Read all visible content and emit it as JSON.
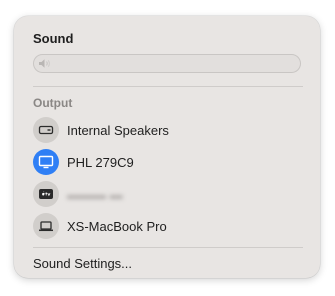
{
  "sound_menu": {
    "title": "Sound",
    "volume_icon": "speaker-muted-icon",
    "output_label": "Output",
    "devices": [
      {
        "label": "Internal Speakers",
        "icon": "speaker-device-icon",
        "selected": false
      },
      {
        "label": "PHL 279C9",
        "icon": "display-icon",
        "selected": true
      },
      {
        "label": "",
        "icon": "apple-tv-icon",
        "selected": false,
        "redacted": true
      },
      {
        "label": "XS-MacBook Pro",
        "icon": "laptop-icon",
        "selected": false
      }
    ],
    "settings_label": "Sound Settings...",
    "colors": {
      "panel_bg": "#e8e5e3",
      "selected_accent": "#2f7ff5",
      "icon_circle": "#d1cecb"
    }
  }
}
